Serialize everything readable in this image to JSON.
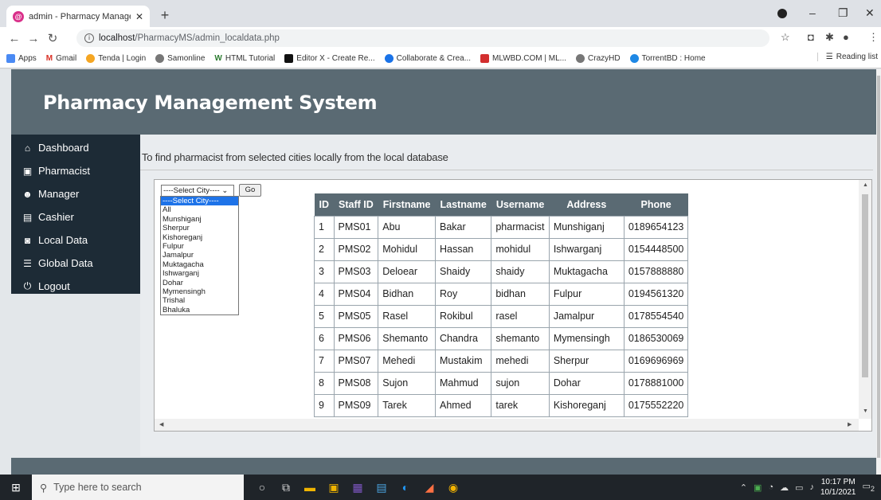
{
  "browser": {
    "tab_title": "admin - Pharmacy Managemnt S",
    "url_host": "localhost",
    "url_path": "/PharmacyMS/admin_localdata.php",
    "bookmarks": [
      "Apps",
      "Gmail",
      "Tenda | Login",
      "Samonline",
      "HTML Tutorial",
      "Editor X - Create Re...",
      "Collaborate & Crea...",
      "MLWBD.COM | ML...",
      "CrazyHD",
      "TorrentBD : Home"
    ],
    "reading_list": "Reading list"
  },
  "app": {
    "title": "Pharmacy Management System",
    "subtitle": "To find pharmacist from selected cities locally from the local database"
  },
  "sidebar": {
    "items": [
      {
        "label": "Dashboard",
        "icon": "home-icon"
      },
      {
        "label": "Pharmacist",
        "icon": "pharmacist-icon"
      },
      {
        "label": "Manager",
        "icon": "users-icon"
      },
      {
        "label": "Cashier",
        "icon": "cashier-icon"
      },
      {
        "label": "Local Data",
        "icon": "database-icon"
      },
      {
        "label": "Global Data",
        "icon": "table-icon"
      },
      {
        "label": "Logout",
        "icon": "power-icon"
      }
    ]
  },
  "filter": {
    "selected": "----Select City----",
    "go_label": "Go",
    "options": [
      "----Select City----",
      "All",
      "Munshiganj",
      "Sherpur",
      "Kishoreganj",
      "Fulpur",
      "Jamalpur",
      "Muktagacha",
      "Ishwarganj",
      "Dohar",
      "Mymensingh",
      "Trishal",
      "Bhaluka"
    ]
  },
  "table": {
    "headers": [
      "ID",
      "Staff ID",
      "Firstname",
      "Lastname",
      "Username",
      "Address",
      "Phone"
    ],
    "rows": [
      [
        "1",
        "PMS01",
        "Abu",
        "Bakar",
        "pharmacist",
        "Munshiganj",
        "0189654123"
      ],
      [
        "2",
        "PMS02",
        "Mohidul",
        "Hassan",
        "mohidul",
        "Ishwarganj",
        "0154448500"
      ],
      [
        "3",
        "PMS03",
        "Deloear",
        "Shaidy",
        "shaidy",
        "Muktagacha",
        "0157888880"
      ],
      [
        "4",
        "PMS04",
        "Bidhan",
        "Roy",
        "bidhan",
        "Fulpur",
        "0194561320"
      ],
      [
        "5",
        "PMS05",
        "Rasel",
        "Rokibul",
        "rasel",
        "Jamalpur",
        "0178554540"
      ],
      [
        "6",
        "PMS06",
        "Shemanto",
        "Chandra",
        "shemanto",
        "Mymensingh",
        "0186530069"
      ],
      [
        "7",
        "PMS07",
        "Mehedi",
        "Mustakim",
        "mehedi",
        "Sherpur",
        "0169696969"
      ],
      [
        "8",
        "PMS08",
        "Sujon",
        "Mahmud",
        "sujon",
        "Dohar",
        "0178881000"
      ],
      [
        "9",
        "PMS09",
        "Tarek",
        "Ahmed",
        "tarek",
        "Kishoreganj",
        "0175552220"
      ]
    ]
  },
  "taskbar": {
    "search_placeholder": "Type here to search",
    "time": "10:17 PM",
    "date": "10/1/2021",
    "notification_count": "2"
  },
  "colors": {
    "header": "#5a6a73",
    "sidebar": "#1d2b36",
    "selected_option": "#1e73e8"
  }
}
